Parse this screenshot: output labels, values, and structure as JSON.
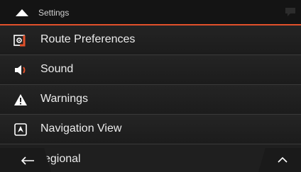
{
  "header": {
    "title": "Settings"
  },
  "menu": {
    "items": [
      {
        "label": "Route Preferences",
        "icon": "route-preferences-icon"
      },
      {
        "label": "Sound",
        "icon": "speaker-icon"
      },
      {
        "label": "Warnings",
        "icon": "warning-icon"
      },
      {
        "label": "Navigation View",
        "icon": "navigation-view-icon"
      }
    ],
    "partial_item": {
      "label": "egional"
    }
  },
  "colors": {
    "accent": "#e2512b",
    "background": "#1f1f1f",
    "header": "#141414"
  }
}
